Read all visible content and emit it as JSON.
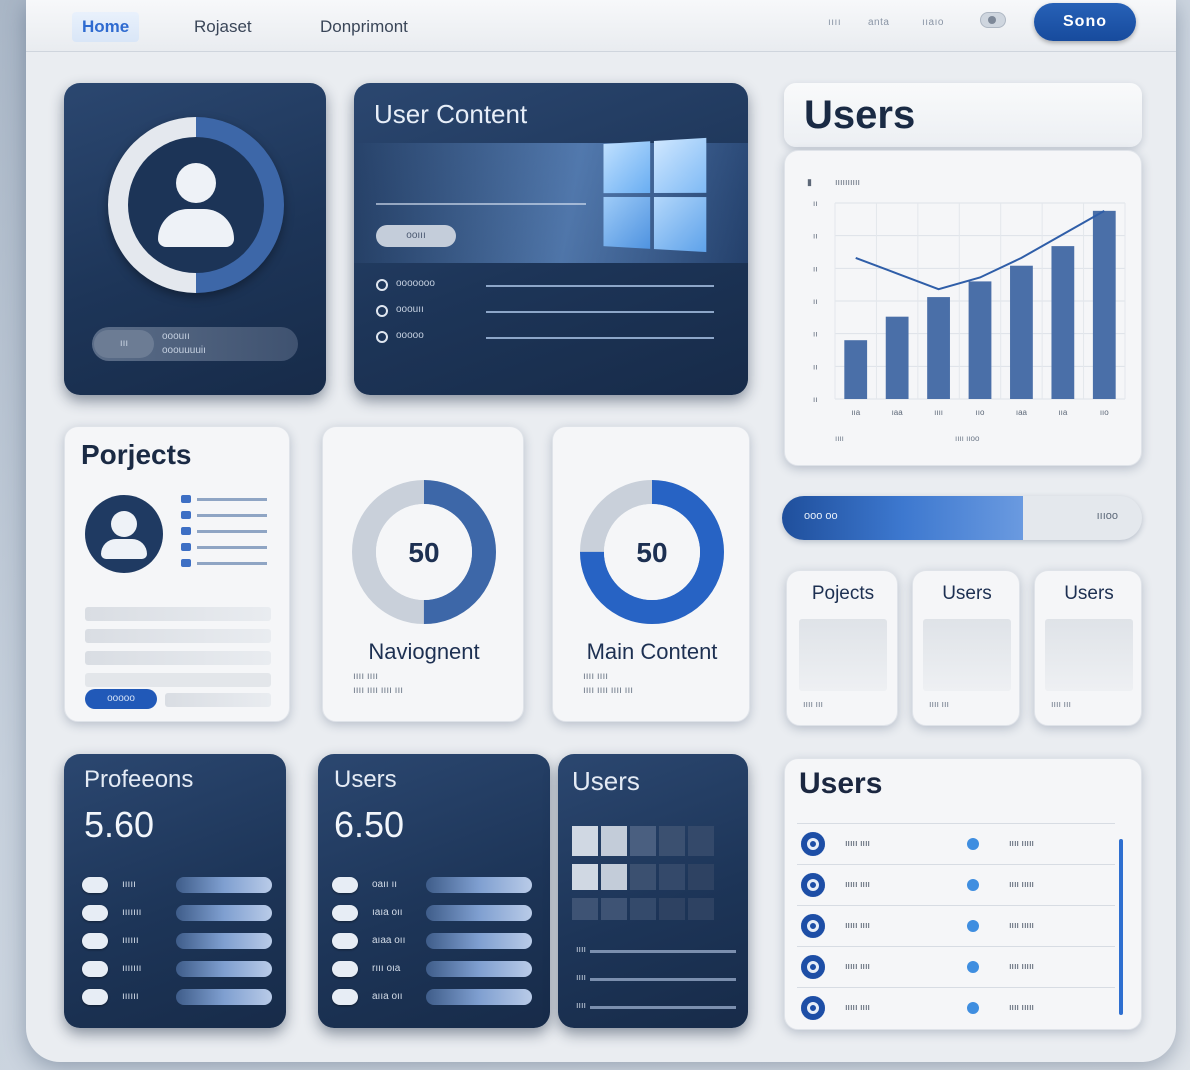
{
  "nav": {
    "items": [
      "Home",
      "Rojaset",
      "Donprimont"
    ],
    "utilities": [
      "ıııı",
      "anta",
      "ııaıo"
    ],
    "signin_label": "Sono"
  },
  "profile_card": {
    "chip_label": "ııı",
    "lines": [
      "ooouıı",
      "ooouuuuiı"
    ]
  },
  "user_content": {
    "title": "User Content",
    "pill_label": "ooııı",
    "items": [
      {
        "icon": "info-icon",
        "label": "ooooooo"
      },
      {
        "icon": "info-icon",
        "label": "ooouıı"
      },
      {
        "icon": "info-icon",
        "label": "ooooo"
      }
    ]
  },
  "users_chart_card": {
    "title": "Users",
    "legend": "ıııııııııı"
  },
  "chart_data": {
    "type": "bar",
    "categories": [
      "ııa",
      "ıaa",
      "ıııı",
      "ııo",
      "ıaa",
      "ııa",
      "ııo"
    ],
    "values": [
      30,
      42,
      52,
      60,
      68,
      78,
      96
    ],
    "line_values": [
      72,
      64,
      56,
      62,
      72,
      84,
      96
    ],
    "ytick_labels": [
      "ıı",
      "ıı",
      "ıı",
      "ıı",
      "ıı",
      "ıı",
      "ıı"
    ],
    "ylim": [
      0,
      100
    ],
    "grid": true,
    "xlabel": "ıııı",
    "footer_label": "ıııı ııoo"
  },
  "projects_card": {
    "title": "Porjects",
    "button_label": "ooooo"
  },
  "donut_left": {
    "value": "50",
    "label": "Naviognent",
    "caption_lines": [
      "ıııı ıııı",
      "ıııı ıııı ıııı ııı"
    ],
    "percent": 50,
    "color": "#3d67a8"
  },
  "donut_right": {
    "value": "50",
    "label": "Main Content",
    "caption_lines": [
      "ıııı ıııı",
      "ıııı ıııı ıııı ııı"
    ],
    "percent": 75,
    "color": "#2763c4"
  },
  "progress": {
    "left_label": "ooo oo",
    "right_label": "ıııoo",
    "percent": 0.67
  },
  "mini_cards": [
    {
      "title": "Pojects",
      "footer": "ıııı ııı"
    },
    {
      "title": "Users",
      "footer": "ıııı ııı"
    },
    {
      "title": "Users",
      "footer": "ıııı ııı"
    }
  ],
  "stat_cards": [
    {
      "title": "Profeeons",
      "value": "5.60",
      "rows": [
        "ııııı",
        "ııııııı",
        "ıııııı",
        "ııııııı",
        "ıııııı"
      ]
    },
    {
      "title": "Users",
      "value": "6.50",
      "rows": [
        "oaıı ıı",
        "ıaıa oıı",
        "aıaa oıı",
        "rııı oıa",
        "aııa oıı"
      ]
    },
    {
      "title": "Users",
      "value": "",
      "rows": [
        "ıııı",
        "ıııı",
        "ıııı"
      ]
    }
  ],
  "users_list": {
    "title": "Users",
    "rows": [
      {
        "name": "ııııı ıııı",
        "value": "ıııı ııııı"
      },
      {
        "name": "ııııı ıııı",
        "value": "ıııı ııııı"
      },
      {
        "name": "ııııı ıııı",
        "value": "ıııı ııııı"
      },
      {
        "name": "ııııı ıııı",
        "value": "ıııı ııııı"
      },
      {
        "name": "ııııı ıııı",
        "value": "ıııı ııııı"
      }
    ]
  },
  "colors": {
    "accent": "#2f6bd0",
    "dark_card": "#1d3558",
    "light_card": "#f5f6f8"
  }
}
